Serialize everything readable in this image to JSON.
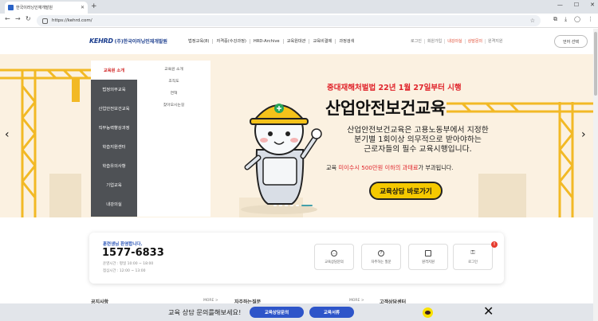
{
  "browser": {
    "tab_title": "한국이러닝인재개발원",
    "new_tab": "+",
    "url": "https://kehrd.com/",
    "window_controls": [
      "—",
      "☐",
      "✕"
    ]
  },
  "header": {
    "logo_mark": "KEHRD",
    "logo_name": "(주)한국이러닝인재개발원",
    "gnb": [
      "법정교육(8)",
      "자격증(수강과정)",
      "HRD-Archive",
      "교육원대관",
      "교육비결제",
      "과정검색"
    ],
    "util": [
      "로그인",
      "회원가입",
      "내강의실",
      "상담문의",
      "원격지원"
    ],
    "lang_button": "언어 선택"
  },
  "menu": {
    "left": [
      "교육원 소개",
      "법정의무교육",
      "산업안전보건교육",
      "직무능력향상과정",
      "학습지원센터",
      "학습유의사항",
      "기업교육",
      "내강의실"
    ],
    "active_index": 0,
    "sub": [
      "교육원 소개",
      "조직도",
      "연혁",
      "찾아오시는길"
    ]
  },
  "hero": {
    "subtitle": "중대재해처벌법 22년 1월 27일부터 시행",
    "title": "산업안전보건교육",
    "desc_lines": [
      "산업안전보건교육은 고용노동부에서 지정한",
      "분기별 1회이상 의무적으로 받아야하는",
      "근로자들의 필수 교육시행입니다."
    ],
    "fine_pre": "교육 ",
    "fine_highlight": "미이수시 500만원 이하의 과태료",
    "fine_post": "가 부과됩니다.",
    "cta": "교육상담 바로가기",
    "prev": "‹",
    "next": "›"
  },
  "contact": {
    "hello": "훈련생님 환영합니다.",
    "phone": "1577-6833",
    "hours1": "운영시간 : 평일 10:00 ~ 18:00",
    "hours2": "점심시간 : 12:00 ~ 13:00",
    "quick": [
      "교육상담문의",
      "자주하는 질문",
      "원격지원",
      "로그인"
    ],
    "badge": "!"
  },
  "sections": [
    {
      "title": "공지사항",
      "more": "MORE >"
    },
    {
      "title": "자주하는질문",
      "more": "MORE >"
    },
    {
      "title": "고객상담센터",
      "more": ""
    }
  ],
  "bottom_bar": {
    "message": "교육 상담 문의를해보세요!",
    "btn1": "교육상담문의",
    "btn2": "교육서류",
    "close": "✕"
  },
  "colors": {
    "brand_blue": "#1d3f8f",
    "accent_red": "#e0242b",
    "cta_yellow": "#f5c900",
    "hero_bg": "#fbf1e1",
    "menu_gray": "#4e5155",
    "button_blue": "#2e55c9"
  }
}
